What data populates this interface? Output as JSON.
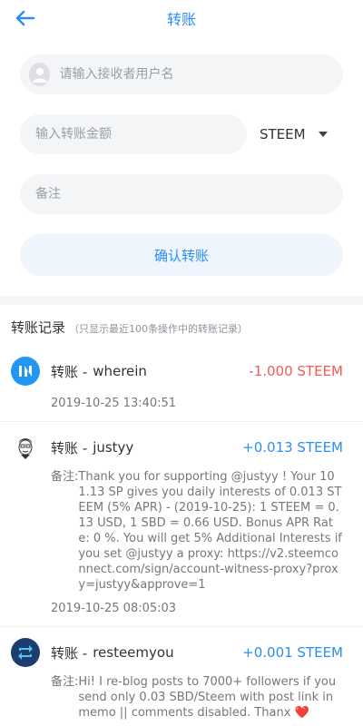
{
  "header": {
    "title": "转账"
  },
  "form": {
    "recipient_placeholder": "请输入接收者用户名",
    "amount_placeholder": "输入转账金额",
    "currency": "STEEM",
    "memo_placeholder": "备注",
    "confirm_label": "确认转账"
  },
  "records": {
    "title": "转账记录",
    "note": "（只显示最近100条操作中的转账记录）",
    "items": [
      {
        "type": "转账 -",
        "name": "wherein",
        "amount": "-1.000 STEEM",
        "time": "2019-10-25 13:40:51",
        "icon": "wherein-logo-icon"
      },
      {
        "type": "转账 -",
        "name": "justyy",
        "amount": "+0.013 STEEM",
        "memo_label": "备注:",
        "memo": "Thank you for supporting @justyy ! Your 101.13 SP gives you daily interests of 0.013 STEEM (5% APR) - (2019-10-25): 1 STEEM = 0.13 USD, 1 SBD = 0.66 USD. Bonus APR Rate: 0 %.  You will get 5% Additional Interests if you set @justyy a proxy: https://v2.steemconnect.com/sign/account-witness-proxy?proxy=justyy&approve=1",
        "time": "2019-10-25 08:05:03",
        "icon": "justyy-avatar-icon"
      },
      {
        "type": "转账 -",
        "name": "resteemyou",
        "amount": "+0.001 STEEM",
        "memo_label": "备注:",
        "memo": "Hi! I re-blog posts to 7000+ followers if you send  only 0.03 SBD/Steem with post link in memo || comments disabled. Thanx ❤️",
        "icon": "resteem-icon"
      }
    ]
  },
  "colors": {
    "accent": "#2b8ef0",
    "negative": "#f25a5a"
  }
}
